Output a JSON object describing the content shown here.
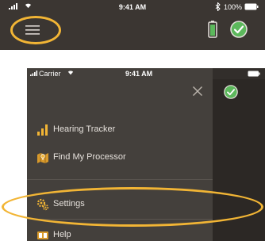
{
  "screen1": {
    "status_bar": {
      "time": "9:41 AM",
      "battery_text": "100%"
    },
    "icons": {
      "menu": "hamburger-menu-icon",
      "device_battery": "battery-icon",
      "status": "check-icon"
    },
    "highlight_color": "#f2b535"
  },
  "screen2": {
    "status_bar": {
      "carrier": "Carrier",
      "time": "9:41 AM"
    },
    "menu_items": [
      {
        "label": "Hearing Tracker",
        "icon": "bar-chart-icon"
      },
      {
        "label": "Find My Processor",
        "icon": "map-pin-icon"
      },
      {
        "label": "Settings",
        "icon": "gears-icon"
      },
      {
        "label": "Help",
        "icon": "help-icon"
      }
    ],
    "highlighted_item": "Settings",
    "accent_colors": {
      "highlight": "#f2b535",
      "check": "#5cb85c"
    }
  }
}
